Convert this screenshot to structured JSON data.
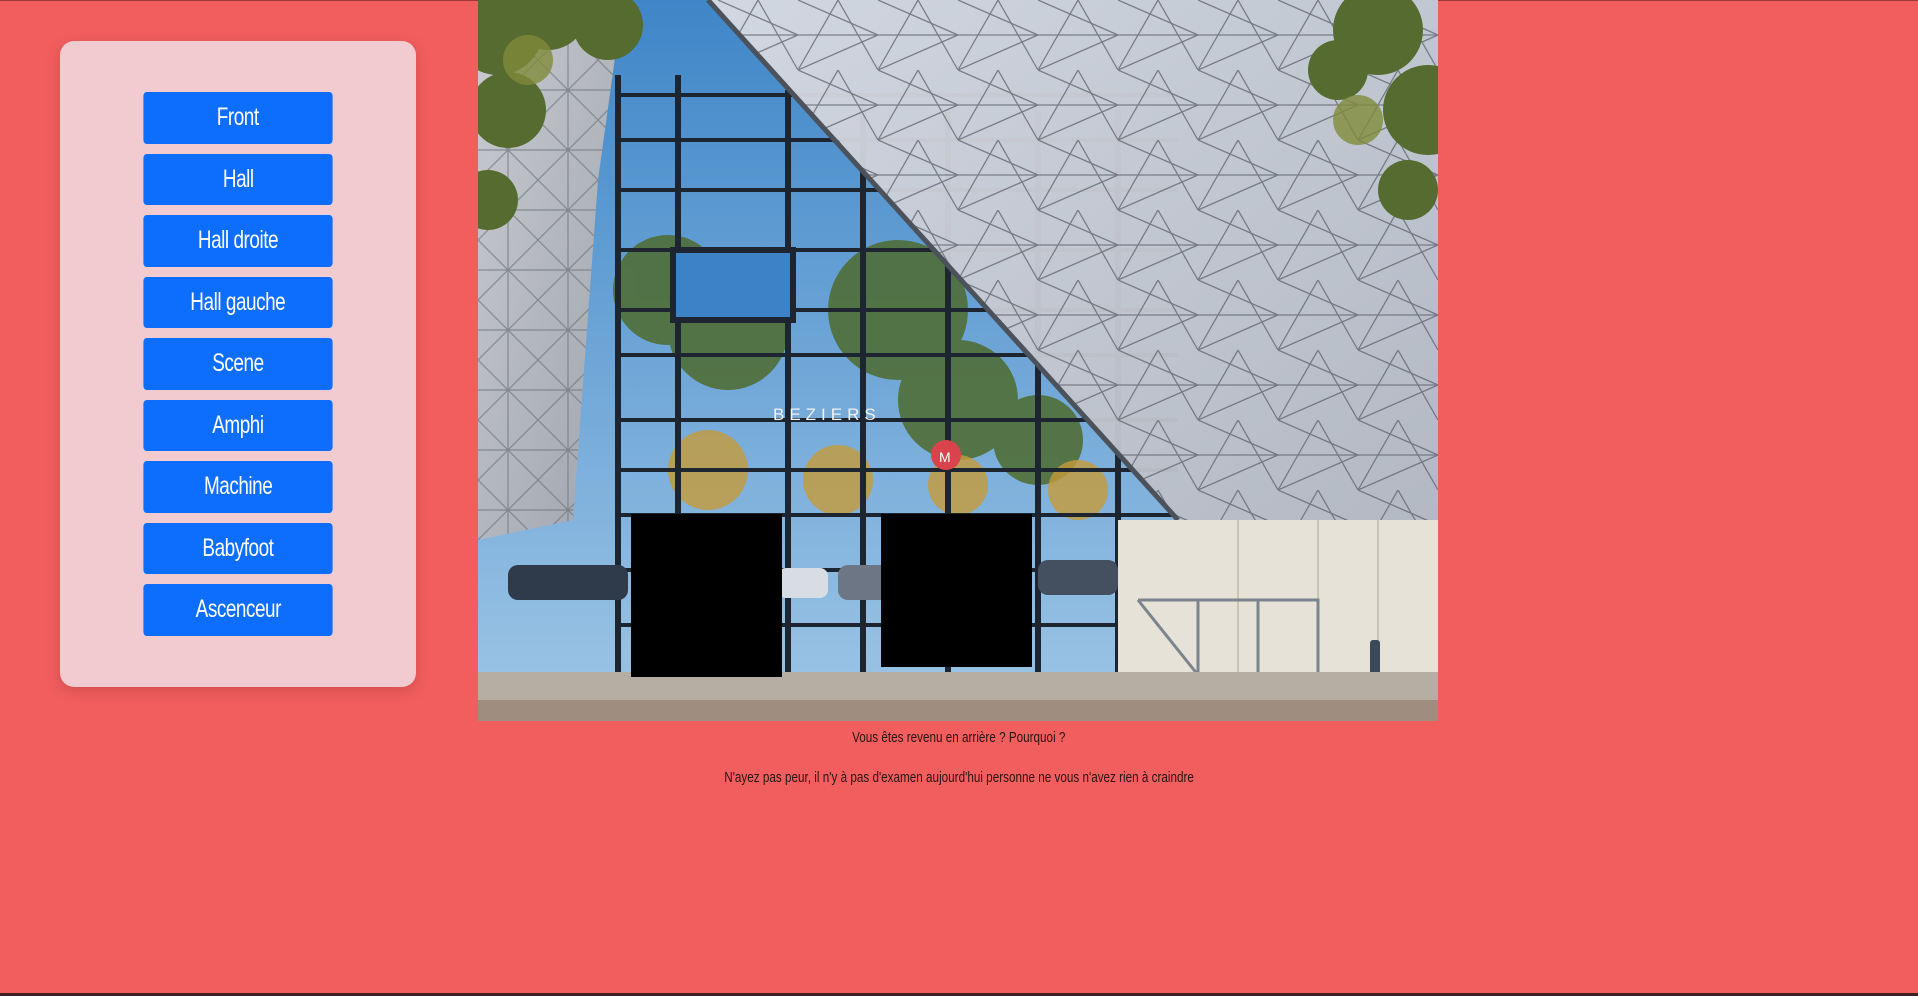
{
  "nav": {
    "items": [
      {
        "label": "Front"
      },
      {
        "label": "Hall"
      },
      {
        "label": "Hall droite"
      },
      {
        "label": "Hall gauche"
      },
      {
        "label": "Scene"
      },
      {
        "label": "Amphi"
      },
      {
        "label": "Machine"
      },
      {
        "label": "Babyfoot"
      },
      {
        "label": "Ascenceur"
      }
    ]
  },
  "photo": {
    "sign_text": "BEZIERS",
    "logo_letter": "M"
  },
  "captions": {
    "line1": "Vous êtes revenu en arrière ? Pourquoi ?",
    "line2": "N'ayez pas peur, il n'y à pas d'examen aujourd'hui personne ne vous n'avez rien à craindre"
  },
  "colors": {
    "background": "#f25e5e",
    "panel": "#f2cbd0",
    "button": "#0d6efd",
    "button_text": "#ffffff",
    "text": "#2a1414"
  }
}
